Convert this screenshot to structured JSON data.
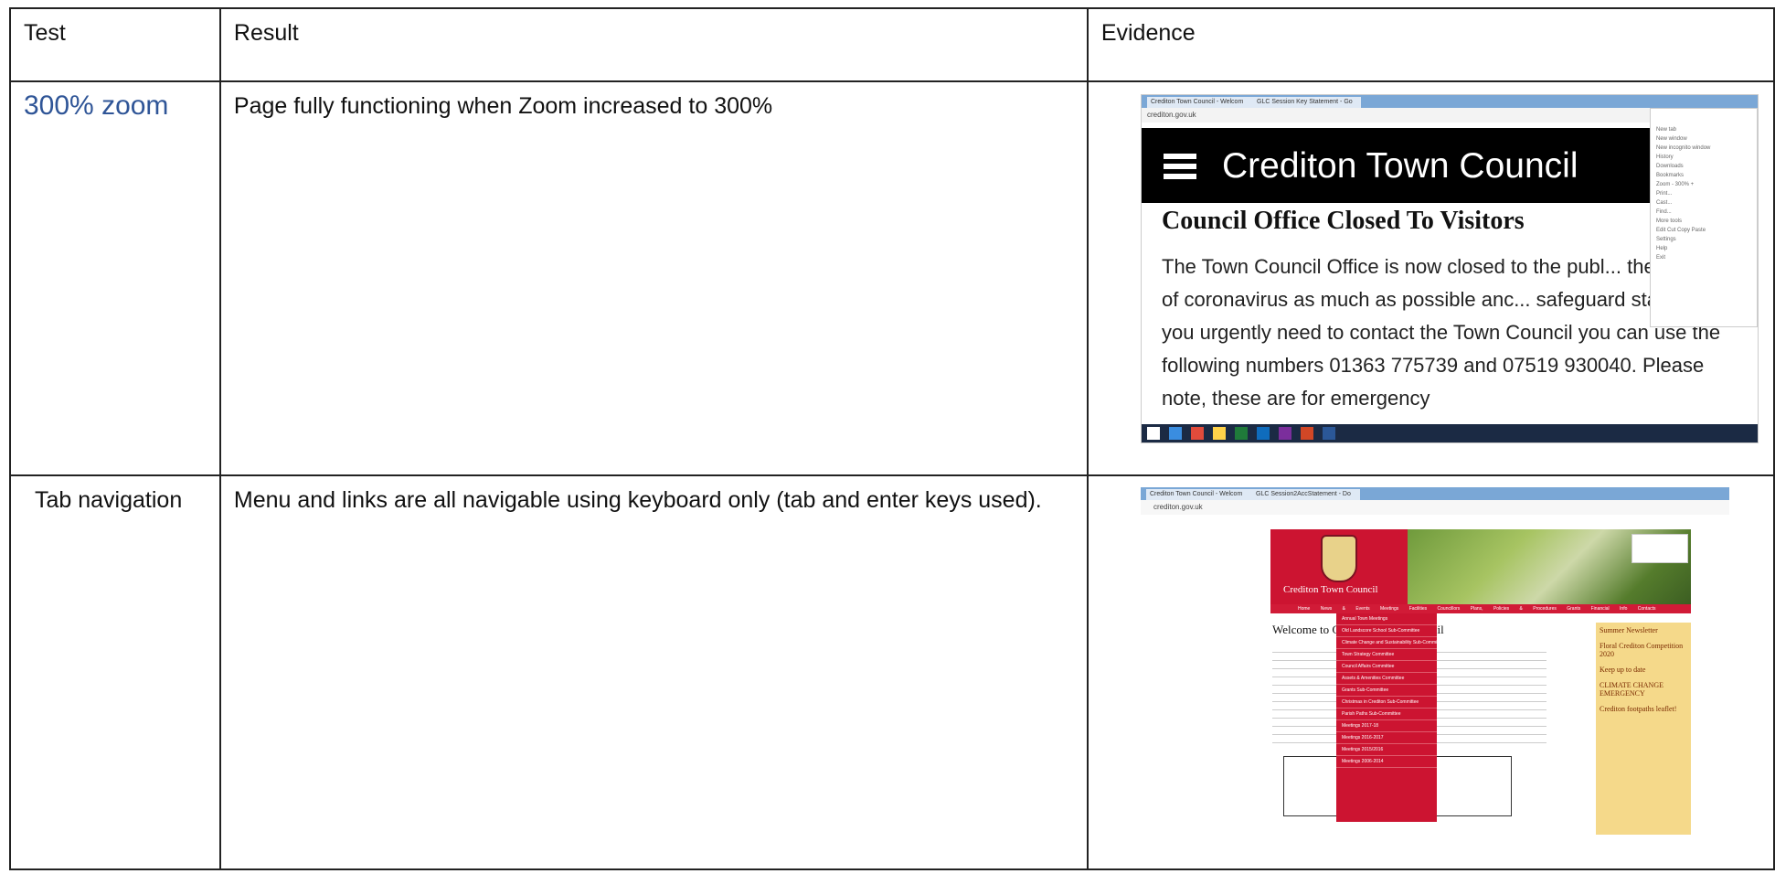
{
  "table": {
    "headers": [
      "Test",
      "Result",
      "Evidence"
    ],
    "rows": [
      {
        "test": "300% zoom",
        "result": "Page fully functioning when Zoom increased to 300%"
      },
      {
        "test": "Tab navigation",
        "result": "Menu and links are all navigable using keyboard only (tab and enter keys used)."
      }
    ]
  },
  "evidence1": {
    "tab1": "Crediton Town Council - Welcom",
    "tab2": "GLC Session Key Statement - Go",
    "address": "crediton.gov.uk",
    "site_title": "Crediton Town Council",
    "heading": "Council Office Closed To Visitors",
    "paragraph": "The Town Council Office is now closed to the publ... the spread of coronavirus as much as possible anc... safeguard staff.  If you urgently need to contact the Town Council you can use the following numbers 01363 775739 and 07519 930040.  Please note, these are for emergency",
    "menu_items": [
      "New tab",
      "New window",
      "New incognito window",
      "History",
      "Downloads",
      "Bookmarks",
      "Zoom  -  300%  +",
      "Print...",
      "Cast...",
      "Find...",
      "More tools",
      "Edit   Cut   Copy   Paste",
      "Settings",
      "Help",
      "Exit"
    ]
  },
  "evidence2": {
    "tab1": "Crediton Town Council - Welcom",
    "tab2": "GLC Session2AccStatement - Do",
    "address": "crediton.gov.uk",
    "site_name": "Crediton Town Council",
    "nav": "Home  News & Events  Meetings  Facilities  Councillors  Plans, Policies & Procedures  Grants  Financial Info  Contacts",
    "dropdown": [
      "Annual Town Meetings",
      "Old Landscore School Sub-Committee",
      "Climate Change and Sustainability Sub-Committee",
      "Town Strategy Committee",
      "Council Affairs Committee",
      "Assets & Amenities Committee",
      "Grants Sub-Committee",
      "Christmas in Crediton Sub-Committee",
      "Parish Paths Sub-Committee",
      "Meetings 2017-18",
      "Meetings 2016-2017",
      "Meetings 2015/2016",
      "Meetings 2006-2014"
    ],
    "welcome": "Welcome to Crediton Town Council",
    "side": [
      "Summer Newsletter",
      "Floral Crediton Competition 2020",
      "Keep up to date",
      "CLIMATE CHANGE EMERGENCY",
      "Crediton footpaths leaflet!"
    ]
  }
}
